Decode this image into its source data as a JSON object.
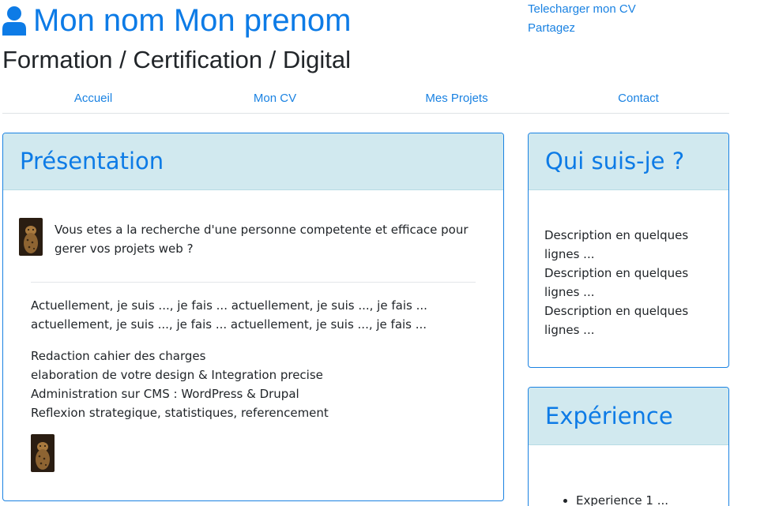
{
  "header": {
    "title": "Mon nom Mon prenom",
    "subtitle": "Formation / Certification / Digital",
    "user_icon": "user-icon",
    "links": [
      "Telecharger mon CV",
      "Partagez"
    ]
  },
  "nav": {
    "items": [
      "Accueil",
      "Mon CV",
      "Mes Projets",
      "Contact"
    ]
  },
  "presentation": {
    "title": "Présentation",
    "intro": "Vous etes a la recherche d'une personne competente et efficace pour gerer vos projets web ?",
    "paragraph": "Actuellement, je suis ..., je fais ... actuellement, je suis ..., je fais ... actuellement, je suis ..., je fais ... actuellement, je suis ..., je fais ...",
    "services": [
      "Redaction cahier des charges",
      "elaboration de votre design & Integration precise",
      "Administration sur CMS : WordPress & Drupal",
      "Reflexion strategique, statistiques, referencement"
    ]
  },
  "qui": {
    "title": "Qui suis-je ?",
    "lines": [
      "Description en quelques lignes ...",
      "Description en quelques lignes ...",
      "Description en quelques lignes ..."
    ]
  },
  "experience": {
    "title": "Expérience",
    "items": [
      "Experience 1 ..."
    ]
  },
  "colors": {
    "link": "#1a82e2",
    "card_header_bg": "#d1e9ef",
    "card_border": "#1a82e2"
  }
}
